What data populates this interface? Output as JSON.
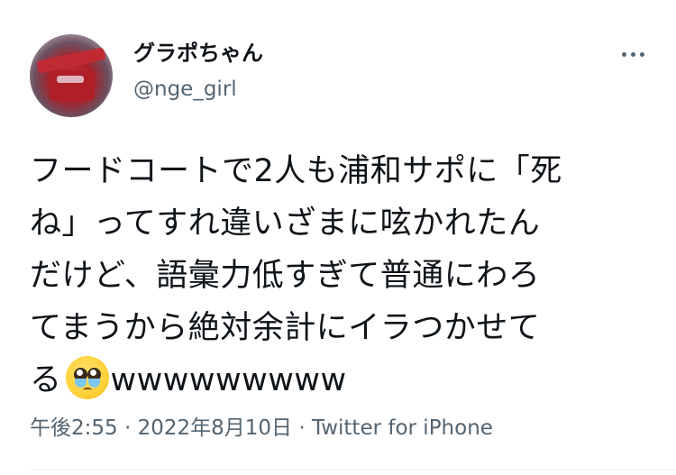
{
  "user": {
    "display_name": "グラポちゃん",
    "handle": "@nge_girl"
  },
  "more_icon": "more-horizontal-icon",
  "tweet": {
    "lines": [
      "フードコートで2人も浦和サポに「死",
      "ね」ってすれ違いざまに呟かれたん",
      "だけど、語彙力低すぎて普通にわろ",
      "てまうから絶対余計にイラつかせて"
    ],
    "last_line_prefix": "る",
    "emoji": "pleading-face-with-tears-emoji",
    "last_line_suffix": "wwwwwwwww"
  },
  "meta": {
    "time": "午後2:55",
    "separator": "·",
    "date": "2022年8月10日",
    "source": "Twitter for iPhone"
  }
}
